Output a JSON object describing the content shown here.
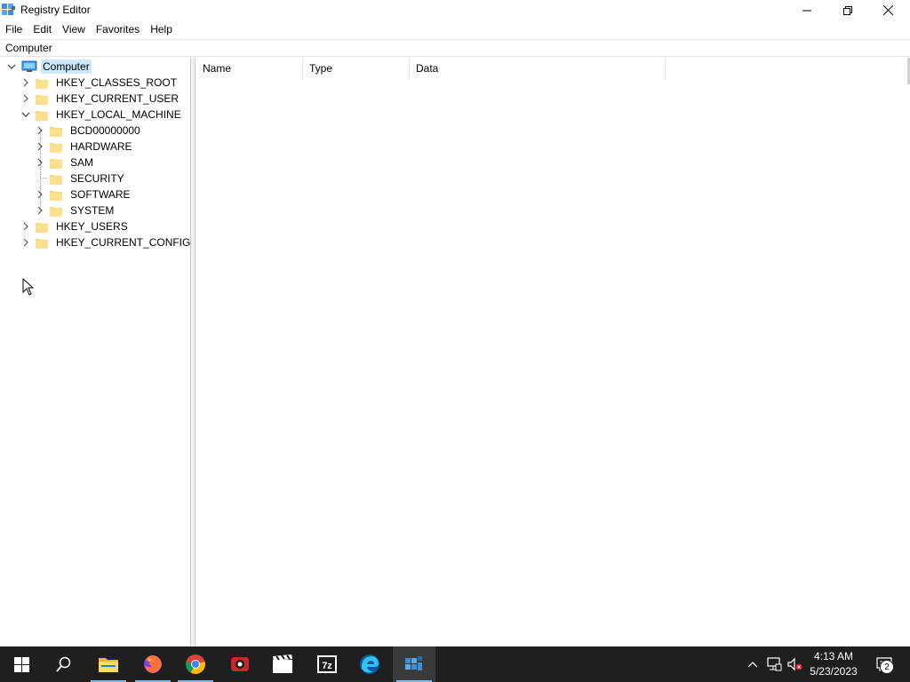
{
  "window": {
    "title": "Registry Editor"
  },
  "menu": [
    "File",
    "Edit",
    "View",
    "Favorites",
    "Help"
  ],
  "address": "Computer",
  "tree": {
    "root": "Computer",
    "hives": [
      {
        "label": "HKEY_CLASSES_ROOT",
        "expanded": false
      },
      {
        "label": "HKEY_CURRENT_USER",
        "expanded": false
      },
      {
        "label": "HKEY_LOCAL_MACHINE",
        "expanded": true,
        "children": [
          {
            "label": "BCD00000000",
            "has_children": true
          },
          {
            "label": "HARDWARE",
            "has_children": true
          },
          {
            "label": "SAM",
            "has_children": true
          },
          {
            "label": "SECURITY",
            "has_children": false
          },
          {
            "label": "SOFTWARE",
            "has_children": true
          },
          {
            "label": "SYSTEM",
            "has_children": true
          }
        ]
      },
      {
        "label": "HKEY_USERS",
        "expanded": false
      },
      {
        "label": "HKEY_CURRENT_CONFIG",
        "expanded": false
      }
    ]
  },
  "list": {
    "columns": [
      "Name",
      "Type",
      "Data"
    ]
  },
  "taskbar": {
    "apps": [
      "start-icon",
      "search-icon",
      "file-explorer-icon",
      "firefox-icon",
      "chrome-icon",
      "screen-recorder-icon",
      "video-editor-icon",
      "7zip-icon",
      "edge-icon",
      "registry-editor-icon"
    ],
    "clock_time": "4:13 AM",
    "clock_date": "5/23/2023",
    "notification_count": "2"
  },
  "colors": {
    "selection": "#cce8ff",
    "taskbar": "#1f1f1f",
    "folder": "#f8d775",
    "accent": "#76b9ed"
  }
}
